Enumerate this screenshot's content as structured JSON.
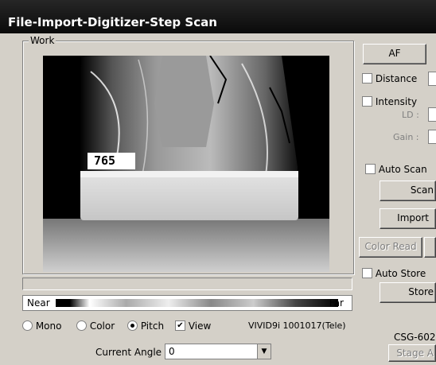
{
  "window": {
    "title": "File-Import-Digitizer-Step Scan"
  },
  "work": {
    "label": "Work",
    "depth_readout": "765"
  },
  "scale": {
    "near_label": "Near",
    "far_label": "Far"
  },
  "display_options": {
    "mono": "Mono",
    "color": "Color",
    "pitch": "Pitch",
    "view": "View",
    "selected": "pitch",
    "view_checked": true
  },
  "scanner_info": "VIVID9i  1001017(Tele)",
  "angle": {
    "label": "Current Angle",
    "value": "0"
  },
  "side_panel": {
    "af_button": "AF",
    "distance_label": "Distance",
    "intensity_label": "Intensity",
    "ld_label": "LD :",
    "gain_label": "Gain :",
    "auto_scan_label": "Auto Scan",
    "scan_button": "Scan",
    "import_button": "Import",
    "color_read_button": "Color Read",
    "auto_store_label": "Auto Store",
    "store_button": "Store",
    "stage_model": "CSG-602",
    "stage_button": "Stage A"
  },
  "colors": {
    "titlebar": "#1a1a1a",
    "face": "#d4d0c8"
  }
}
